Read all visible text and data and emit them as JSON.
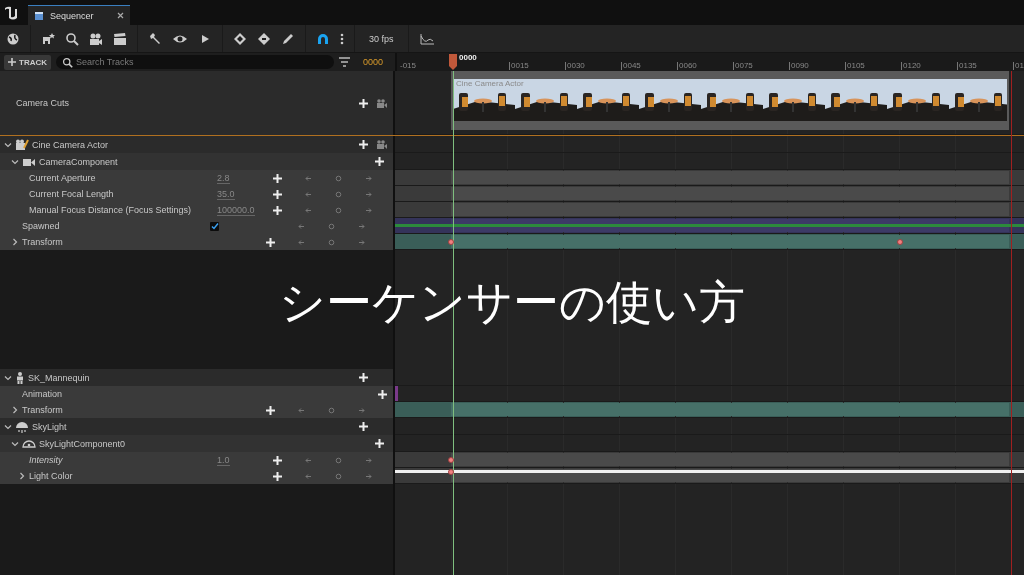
{
  "app": {
    "tab": {
      "title": "Sequencer",
      "selected": true
    }
  },
  "toolbar": {
    "frame_rate": "30 fps",
    "snapping_on": true
  },
  "track_header": {
    "add_button": "TRACK",
    "search": {
      "placeholder": "Search Tracks"
    },
    "current_frame": "0000"
  },
  "ruler": {
    "playhead": "0000",
    "labels": [
      "-015",
      "0015",
      "0030",
      "0045",
      "0060",
      "0075",
      "0090",
      "0105",
      "0120",
      "0135",
      "01"
    ]
  },
  "tracks": [
    {
      "kind": "cuts",
      "name": "Camera Cuts",
      "section": {
        "kind": "thumbnails",
        "label": "Cine Camera Actor"
      }
    },
    {
      "kind": "actor",
      "name": "Cine Camera Actor",
      "expanded": true,
      "children": [
        {
          "kind": "component",
          "name": "CameraComponent",
          "expanded": true,
          "children": [
            {
              "kind": "property",
              "name": "Current Aperture",
              "value": "2.8",
              "section": {
                "kind": "float"
              }
            },
            {
              "kind": "property",
              "name": "Current Focal Length",
              "value": "35.0",
              "section": {
                "kind": "float"
              }
            },
            {
              "kind": "property",
              "name": "Manual Focus Distance (Focus Settings)",
              "value": "100000.0",
              "section": {
                "kind": "float"
              }
            }
          ]
        },
        {
          "kind": "bool",
          "name": "Spawned",
          "checked": true,
          "section": {
            "kind": "bool"
          }
        },
        {
          "kind": "property",
          "name": "Transform",
          "expanded": false,
          "section": {
            "kind": "transform",
            "keys": [
              {
                "level": 0
              },
              {
                "level": 0.805
              }
            ]
          }
        }
      ]
    },
    {
      "kind": "actor",
      "name": "SK_Mannequin",
      "expanded": true,
      "children": [
        {
          "kind": "animation",
          "name": "Animation"
        },
        {
          "kind": "property",
          "name": "Transform",
          "expanded": false,
          "section": {
            "kind": "transform"
          }
        }
      ]
    },
    {
      "kind": "actor",
      "name": "SkyLight",
      "expanded": true,
      "children": [
        {
          "kind": "component",
          "name": "SkyLightComponent0",
          "expanded": true,
          "children": [
            {
              "kind": "property",
              "name": "Intensity",
              "value": "1.0",
              "italic": true,
              "section": {
                "kind": "float",
                "keys": [
                  {
                    "level": 0
                  }
                ]
              }
            },
            {
              "kind": "property",
              "name": "Light Color",
              "expanded": false,
              "section": {
                "kind": "color",
                "keys": [
                  {
                    "level": 0
                  }
                ]
              }
            }
          ]
        }
      ]
    }
  ],
  "overlay_title": "シーケンサーの使い方"
}
